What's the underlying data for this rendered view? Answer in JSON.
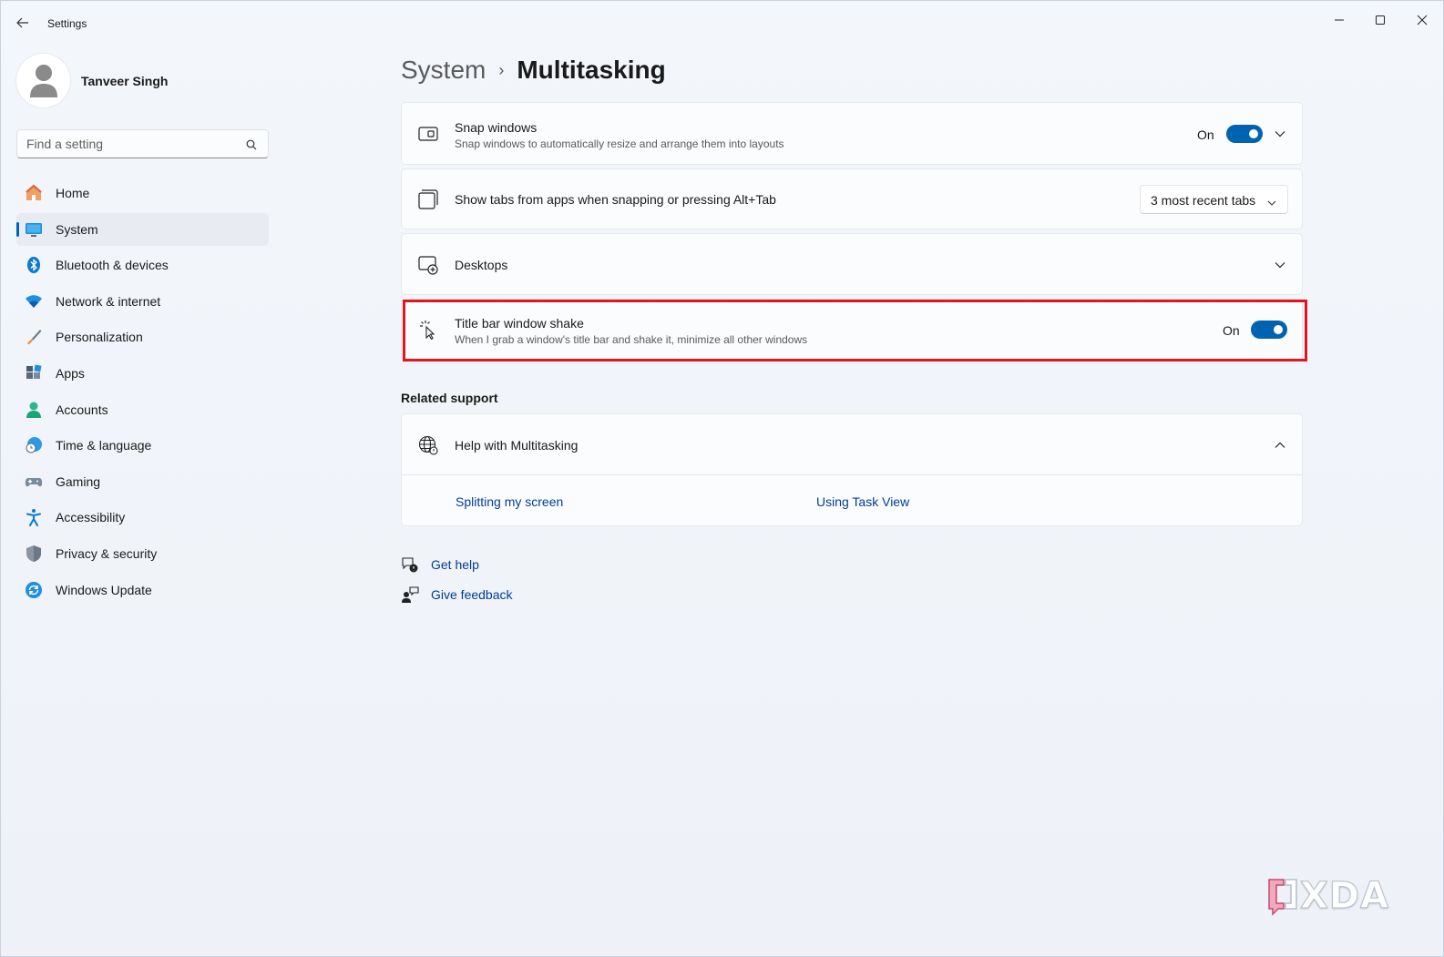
{
  "window": {
    "title": "Settings",
    "controls": {
      "minimize": "minimize",
      "maximize": "maximize",
      "close": "close"
    }
  },
  "profile": {
    "name": "Tanveer Singh"
  },
  "search": {
    "placeholder": "Find a setting"
  },
  "sidebar": {
    "items": [
      {
        "label": "Home",
        "icon": "home-icon"
      },
      {
        "label": "System",
        "icon": "system-icon",
        "active": true
      },
      {
        "label": "Bluetooth & devices",
        "icon": "bluetooth-icon"
      },
      {
        "label": "Network & internet",
        "icon": "wifi-icon"
      },
      {
        "label": "Personalization",
        "icon": "brush-icon"
      },
      {
        "label": "Apps",
        "icon": "apps-icon"
      },
      {
        "label": "Accounts",
        "icon": "accounts-icon"
      },
      {
        "label": "Time & language",
        "icon": "globe-clock-icon"
      },
      {
        "label": "Gaming",
        "icon": "gamepad-icon"
      },
      {
        "label": "Accessibility",
        "icon": "accessibility-icon"
      },
      {
        "label": "Privacy & security",
        "icon": "shield-icon"
      },
      {
        "label": "Windows Update",
        "icon": "update-icon"
      }
    ]
  },
  "breadcrumb": {
    "parent": "System",
    "separator": "›",
    "current": "Multitasking"
  },
  "settings": {
    "snap_windows": {
      "title": "Snap windows",
      "description": "Snap windows to automatically resize and arrange them into layouts",
      "state_label": "On",
      "enabled": true
    },
    "show_tabs": {
      "title": "Show tabs from apps when snapping or pressing Alt+Tab",
      "selected": "3 most recent tabs"
    },
    "desktops": {
      "title": "Desktops"
    },
    "title_bar_shake": {
      "title": "Title bar window shake",
      "description": "When I grab a window's title bar and shake it, minimize all other windows",
      "state_label": "On",
      "enabled": true
    }
  },
  "related_support": {
    "heading": "Related support",
    "help_title": "Help with Multitasking",
    "links": [
      "Splitting my screen",
      "Using Task View"
    ]
  },
  "footer_links": {
    "get_help": "Get help",
    "give_feedback": "Give feedback"
  },
  "watermark": {
    "text": "XDA"
  },
  "colors": {
    "accent": "#0063b1",
    "highlight": "#e0161f",
    "link": "#003e92"
  }
}
